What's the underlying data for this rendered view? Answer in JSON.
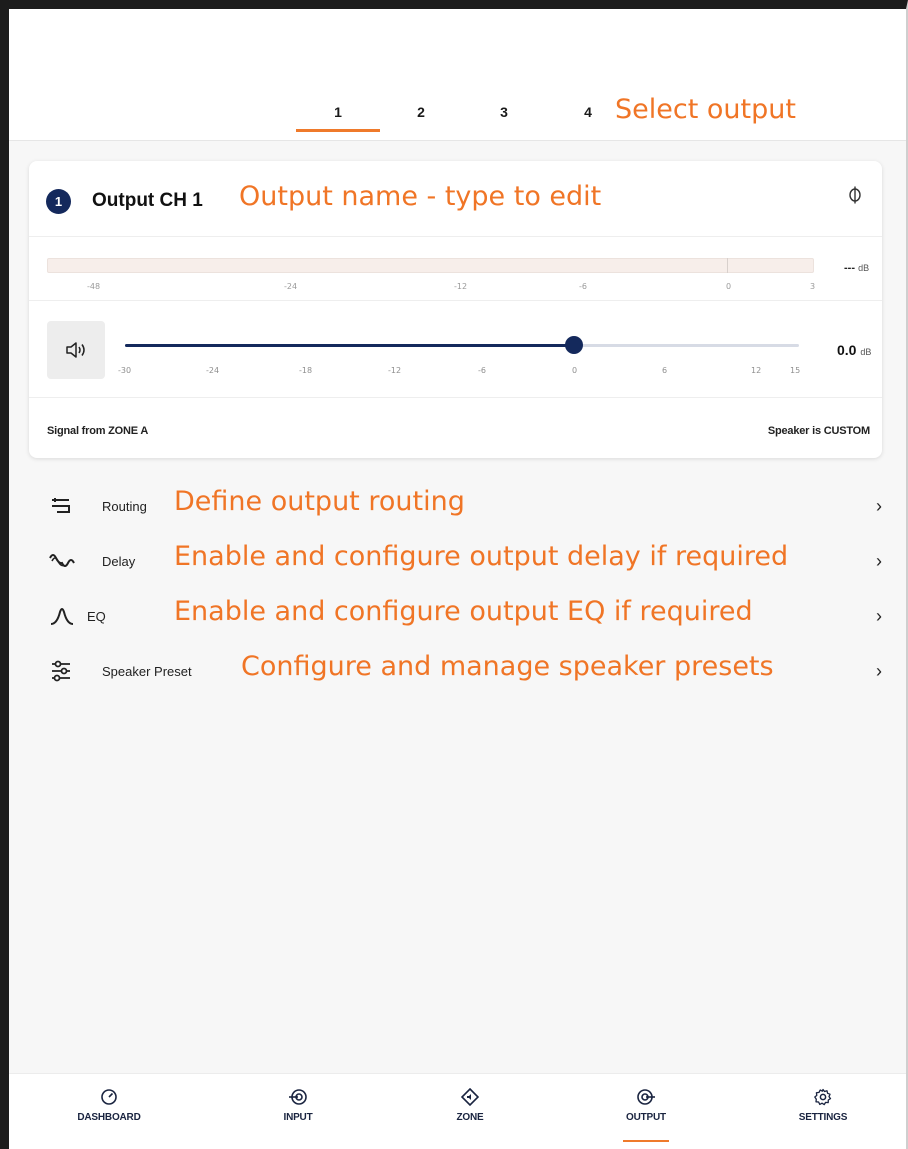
{
  "tabs": [
    "1",
    "2",
    "3",
    "4"
  ],
  "annotations": {
    "select_output": "Select output",
    "output_name": "Output name - type to edit",
    "routing": "Define output routing",
    "delay": "Enable and configure output delay if required",
    "eq": "Enable and configure output EQ if required",
    "speaker_preset": "Configure and manage speaker presets"
  },
  "card": {
    "badge": "1",
    "output_name": "Output CH 1",
    "phase_icon": "phase-invert-icon",
    "meter": {
      "ticks": [
        "-48",
        "-24",
        "-12",
        "-6",
        "0",
        "3"
      ],
      "readout_value": "---",
      "readout_unit": "dB"
    },
    "gain": {
      "ticks": [
        "-30",
        "-24",
        "-18",
        "-12",
        "-6",
        "0",
        "6",
        "12",
        "15"
      ],
      "value_db": 0.0,
      "min_db": -30,
      "max_db": 15,
      "readout_value": "0.0",
      "readout_unit": "dB"
    },
    "signal_from": "Signal from ZONE A",
    "speaker_is": "Speaker is CUSTOM"
  },
  "menu": [
    {
      "label": "Routing",
      "icon": "routing-icon"
    },
    {
      "label": "Delay",
      "icon": "delay-icon"
    },
    {
      "label": "EQ",
      "icon": "eq-icon"
    },
    {
      "label": "Speaker Preset",
      "icon": "sliders-icon"
    }
  ],
  "nav": [
    {
      "label": "DASHBOARD",
      "icon": "gauge-icon"
    },
    {
      "label": "INPUT",
      "icon": "input-icon"
    },
    {
      "label": "ZONE",
      "icon": "zone-icon"
    },
    {
      "label": "OUTPUT",
      "icon": "output-icon",
      "active": true
    },
    {
      "label": "SETTINGS",
      "icon": "gear-icon"
    }
  ],
  "colors": {
    "accent": "#ef7a2b",
    "annotation": "#f07526",
    "navy": "#14295c"
  }
}
